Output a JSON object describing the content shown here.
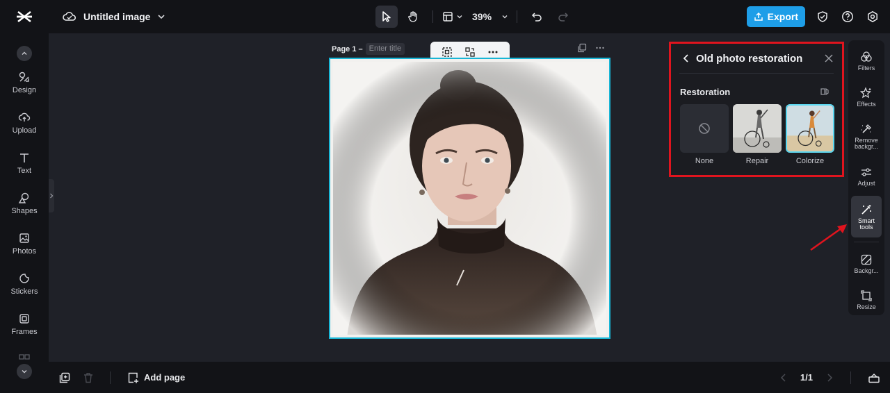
{
  "header": {
    "title": "Untitled image",
    "zoom": "39%",
    "export_label": "Export"
  },
  "sidebar": {
    "items": [
      {
        "label": "Design",
        "icon": "design-icon"
      },
      {
        "label": "Upload",
        "icon": "upload-icon"
      },
      {
        "label": "Text",
        "icon": "text-icon"
      },
      {
        "label": "Shapes",
        "icon": "shapes-icon"
      },
      {
        "label": "Photos",
        "icon": "photos-icon"
      },
      {
        "label": "Stickers",
        "icon": "stickers-icon"
      },
      {
        "label": "Frames",
        "icon": "frames-icon"
      }
    ]
  },
  "canvas": {
    "page_label": "Page 1 –",
    "title_placeholder": "Enter title"
  },
  "panel": {
    "title": "Old photo restoration",
    "section": "Restoration",
    "options": [
      {
        "label": "None",
        "selected": false
      },
      {
        "label": "Repair",
        "selected": false
      },
      {
        "label": "Colorize",
        "selected": true
      }
    ]
  },
  "tools": {
    "items": [
      {
        "label": "Filters",
        "icon": "filters-icon",
        "active": false
      },
      {
        "label": "Effects",
        "icon": "effects-icon",
        "active": false
      },
      {
        "label": "Remove backgr...",
        "icon": "remove-background-icon",
        "active": false
      },
      {
        "label": "Adjust",
        "icon": "adjust-icon",
        "active": false
      },
      {
        "label": "Smart tools",
        "icon": "smart-tools-icon",
        "active": true
      },
      {
        "label": "Backgr...",
        "icon": "background-icon",
        "active": false
      },
      {
        "label": "Resize",
        "icon": "resize-icon",
        "active": false
      }
    ]
  },
  "footer": {
    "add_page_label": "Add page",
    "pager": "1/1"
  },
  "colors": {
    "accent": "#1e9ee8",
    "selection": "#19b6d6",
    "highlight": "#e0141e"
  }
}
